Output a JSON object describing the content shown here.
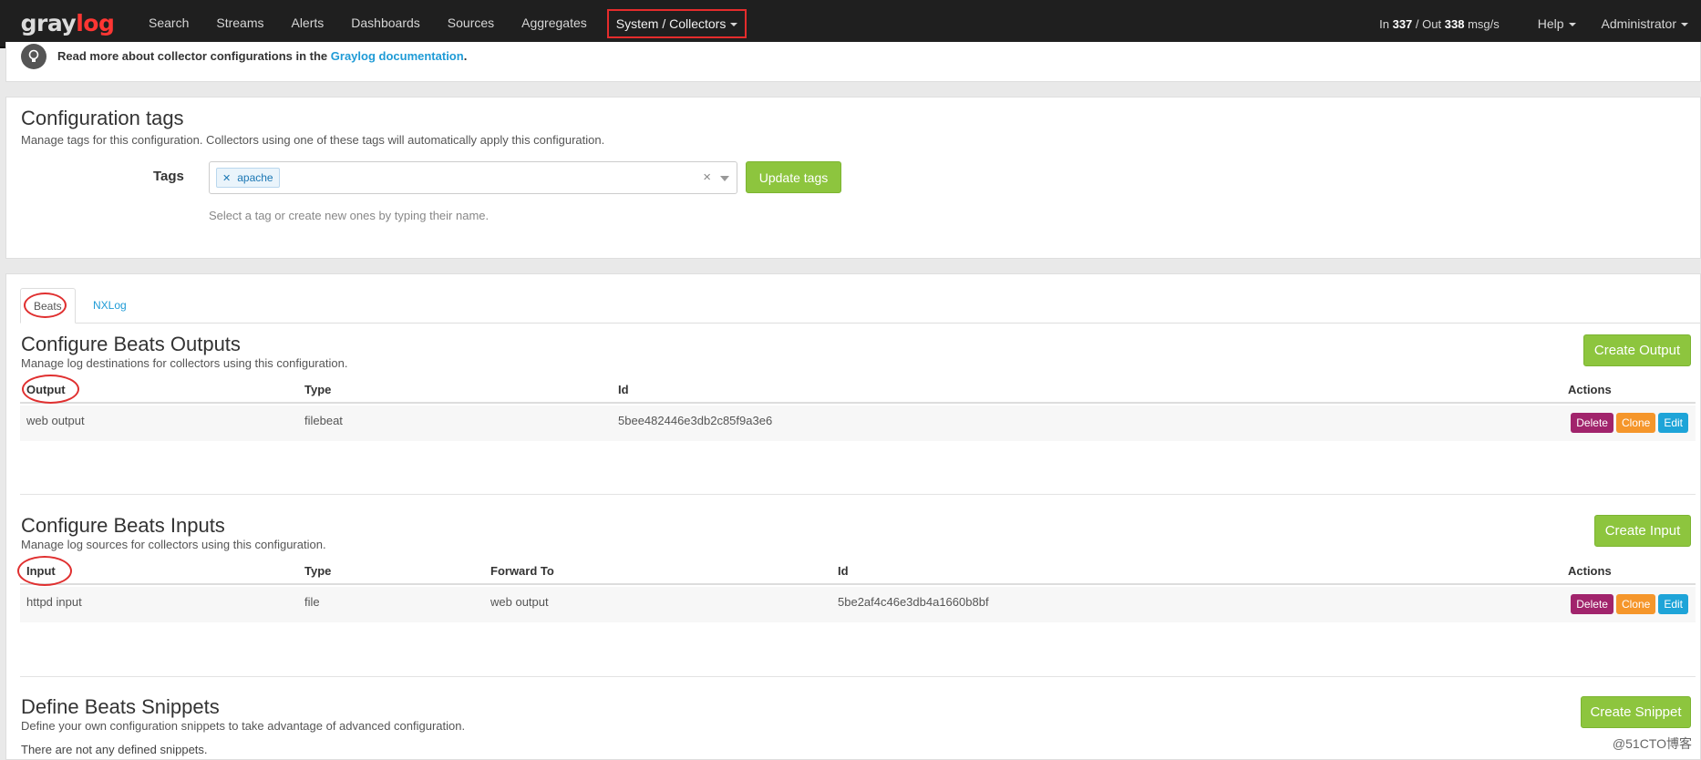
{
  "navbar": {
    "logo_part1": "gray",
    "logo_part2": "log",
    "items": [
      "Search",
      "Streams",
      "Alerts",
      "Dashboards",
      "Sources",
      "Aggregates"
    ],
    "active_item": "System / Collectors",
    "throughput_in_label": "In",
    "throughput_in": "337",
    "throughput_sep": "/ Out",
    "throughput_out": "338",
    "throughput_unit": "msg/s",
    "help": "Help",
    "user": "Administrator"
  },
  "info": {
    "text": "Read more about collector configurations in the",
    "link": "Graylog documentation",
    "suffix": "."
  },
  "tags_section": {
    "title": "Configuration tags",
    "description": "Manage tags for this configuration. Collectors using one of these tags will automatically apply this configuration.",
    "label": "Tags",
    "tags": [
      "apache"
    ],
    "clear": "×",
    "help": "Select a tag or create new ones by typing their name.",
    "update_button": "Update tags"
  },
  "tabs": [
    "Beats",
    "NXLog"
  ],
  "outputs": {
    "title": "Configure Beats Outputs",
    "description": "Manage log destinations for collectors using this configuration.",
    "create_button": "Create Output",
    "headers": [
      "Output",
      "Type",
      "Id",
      "Actions"
    ],
    "rows": [
      {
        "name": "web output",
        "type": "filebeat",
        "id": "5bee482446e3db2c85f9a3e6"
      }
    ]
  },
  "inputs": {
    "title": "Configure Beats Inputs",
    "description": "Manage log sources for collectors using this configuration.",
    "create_button": "Create Input",
    "headers": [
      "Input",
      "Type",
      "Forward To",
      "Id",
      "Actions"
    ],
    "rows": [
      {
        "name": "httpd input",
        "type": "file",
        "forward_to": "web output",
        "id": "5be2af4c46e3db4a1660b8bf"
      }
    ]
  },
  "snippets": {
    "title": "Define Beats Snippets",
    "description": "Define your own configuration snippets to take advantage of advanced configuration.",
    "create_button": "Create Snippet",
    "empty": "There are not any defined snippets."
  },
  "row_actions": {
    "delete": "Delete",
    "clone": "Clone",
    "edit": "Edit"
  },
  "watermark": "@51CTO博客",
  "colors": {
    "navbar": "#1f1f1f",
    "success": "#8dc53e",
    "link": "#1f9bd6",
    "delete": "#a1246c",
    "clone": "#f5962b",
    "edit": "#1ea4d8",
    "annotation": "#e03030"
  }
}
